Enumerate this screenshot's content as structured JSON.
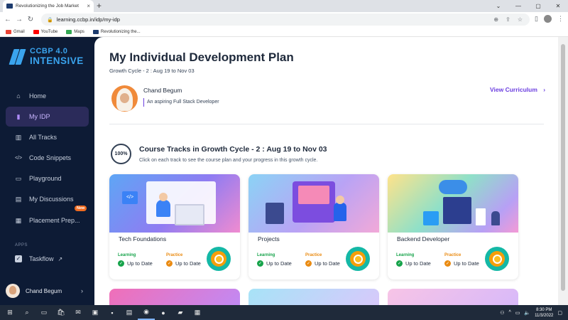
{
  "browser": {
    "tab_title": "Revolutionizing the Job Market",
    "tab_close": "×",
    "new_tab": "+",
    "url": "learning.ccbp.in/idp/my-idp",
    "bookmarks": [
      {
        "label": "Gmail",
        "color": "#ea4335"
      },
      {
        "label": "YouTube",
        "color": "#ff0000"
      },
      {
        "label": "Maps",
        "color": "#34a853"
      },
      {
        "label": "Revolutionizing the...",
        "color": "#1d3b6e"
      }
    ]
  },
  "sidebar": {
    "logo_line1": "CCBP 4.0",
    "logo_line2": "INTENSIVE",
    "items": [
      {
        "label": "Home",
        "icon": "home-icon",
        "glyph": "⌂"
      },
      {
        "label": "My IDP",
        "icon": "idp-icon",
        "glyph": "▮"
      },
      {
        "label": "All Tracks",
        "icon": "tracks-icon",
        "glyph": "▥"
      },
      {
        "label": "Code Snippets",
        "icon": "code-icon",
        "glyph": "</>"
      },
      {
        "label": "Playground",
        "icon": "playground-icon",
        "glyph": "▭"
      },
      {
        "label": "My Discussions",
        "icon": "discussions-icon",
        "glyph": "▤"
      },
      {
        "label": "Placement Prep...",
        "icon": "placement-icon",
        "glyph": "▦"
      }
    ],
    "new_badge": "New",
    "apps_label": "APPS",
    "taskflow_label": "Taskflow",
    "user_name": "Chand Begum"
  },
  "main": {
    "title": "My Individual Development Plan",
    "subtitle": "Growth Cycle - 2 : Aug 19 to Nov 03",
    "profile_name": "Chand Begum",
    "profile_tagline": "An aspiring Full Stack Developer",
    "view_curriculum": "View Curriculum",
    "progress": "100%",
    "progress_value": 1.0,
    "section_title": "Course Tracks in Growth Cycle - 2 : Aug 19 to Nov 03",
    "section_subtitle": "Click on each track to see the course plan and your progress in this growth cycle.",
    "cards": [
      {
        "title": "Tech Foundations",
        "learning_label": "Learning",
        "learning_status": "Up to Date",
        "practice_label": "Practice",
        "practice_status": "Up to Date"
      },
      {
        "title": "Projects",
        "learning_label": "Learning",
        "learning_status": "Up to Date",
        "practice_label": "Practice",
        "practice_status": "Up to Date"
      },
      {
        "title": "Backend Developer",
        "learning_label": "Learning",
        "learning_status": "Up to Date",
        "practice_label": "Practice",
        "practice_status": "Up to Date"
      }
    ]
  },
  "taskbar": {
    "time": "8:30 PM",
    "date": "11/3/2022"
  },
  "colors": {
    "accent": "#6c3fe0",
    "sidebar_bg": "#0d1b35",
    "learning": "#16a34a",
    "practice": "#ea8b12"
  }
}
